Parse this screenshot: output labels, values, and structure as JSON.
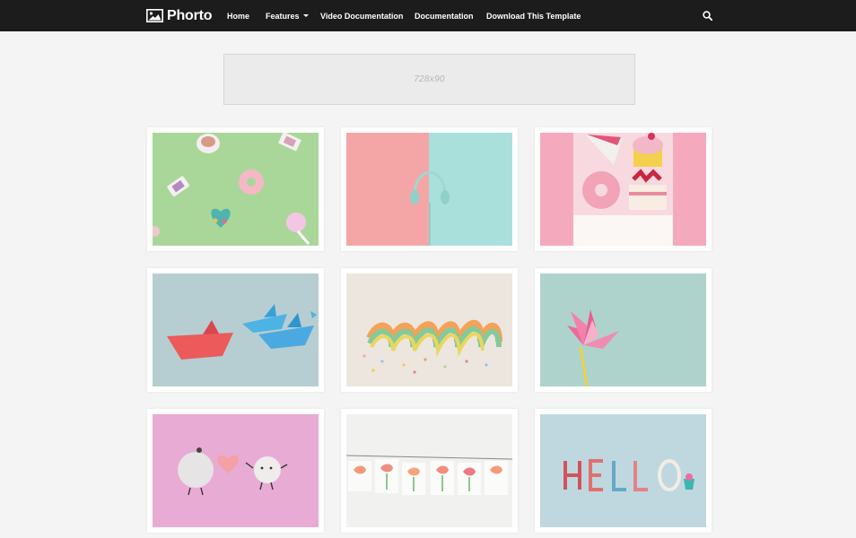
{
  "header": {
    "logo_text": "Phorto",
    "logo_icon": "image-icon",
    "nav": [
      {
        "label": "Home"
      },
      {
        "label": "Features",
        "has_dropdown": true
      },
      {
        "label": "Video Documentation"
      },
      {
        "label": "Documentation"
      },
      {
        "label": "Download This Template"
      }
    ],
    "search_icon": "search-icon",
    "background": "#1c1c1c"
  },
  "ad": {
    "label": "728x90"
  },
  "gallery": {
    "items": [
      {
        "subject": "sweets-on-green"
      },
      {
        "subject": "headphones-pink-teal"
      },
      {
        "subject": "cakes-donut-pink"
      },
      {
        "subject": "paper-boats"
      },
      {
        "subject": "rainbow-ribbon"
      },
      {
        "subject": "pink-paper-flower"
      },
      {
        "subject": "felt-balls-heart"
      },
      {
        "subject": "hanging-flower-cards"
      },
      {
        "subject": "hello-letters"
      }
    ]
  }
}
